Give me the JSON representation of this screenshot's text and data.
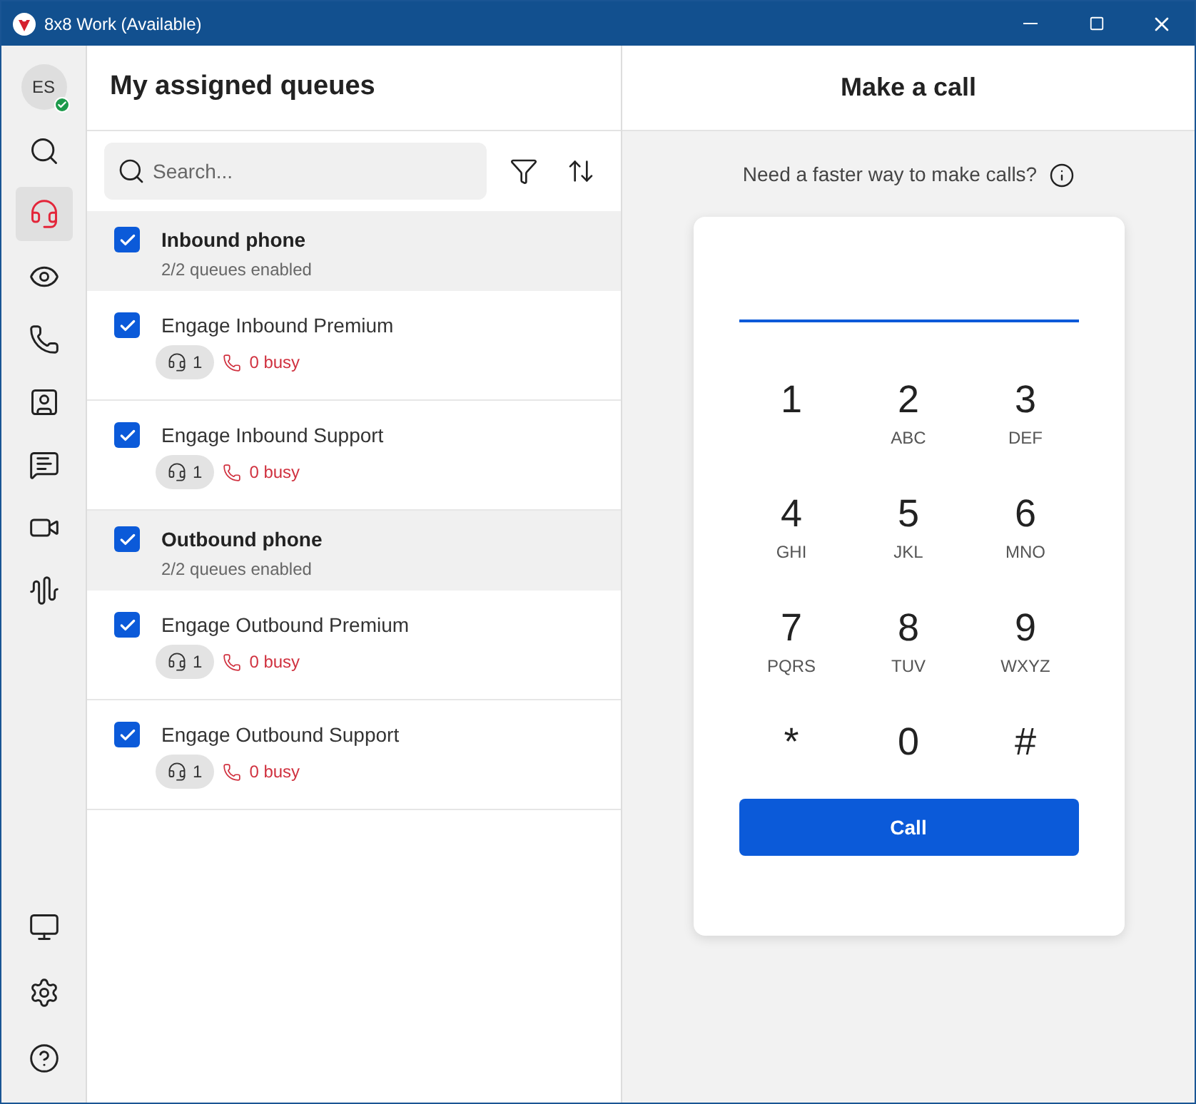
{
  "window": {
    "title": "8x8 Work (Available)"
  },
  "user": {
    "initials": "ES",
    "available": true
  },
  "nav": [
    {
      "selected": false
    },
    {
      "selected": true
    },
    {
      "selected": false
    },
    {
      "selected": false
    },
    {
      "selected": false
    },
    {
      "selected": false
    },
    {
      "selected": false
    },
    {
      "selected": false
    }
  ],
  "queues_panel": {
    "title": "My assigned queues",
    "search": {
      "placeholder": "Search..."
    },
    "rows": [
      {
        "kind": "group",
        "name": "Inbound phone",
        "subtitle": "2/2 queues enabled",
        "checked": true
      },
      {
        "kind": "queue",
        "name": "Engage Inbound Premium",
        "agents": "1",
        "busy": "0 busy",
        "checked": true
      },
      {
        "kind": "queue",
        "name": "Engage Inbound Support",
        "agents": "1",
        "busy": "0 busy",
        "checked": true
      },
      {
        "kind": "group",
        "name": "Outbound phone",
        "subtitle": "2/2 queues enabled",
        "checked": true
      },
      {
        "kind": "queue",
        "name": "Engage Outbound Premium",
        "agents": "1",
        "busy": "0 busy",
        "checked": true
      },
      {
        "kind": "queue",
        "name": "Engage Outbound Support",
        "agents": "1",
        "busy": "0 busy",
        "checked": true
      }
    ]
  },
  "call_panel": {
    "title": "Make a call",
    "hint": "Need a faster way to make calls?",
    "keys": [
      {
        "digit": "1"
      },
      {
        "digit": "2",
        "letters": "ABC"
      },
      {
        "digit": "3",
        "letters": "DEF"
      },
      {
        "digit": "4",
        "letters": "GHI"
      },
      {
        "digit": "5",
        "letters": "JKL"
      },
      {
        "digit": "6",
        "letters": "MNO"
      },
      {
        "digit": "7",
        "letters": "PQRS"
      },
      {
        "digit": "8",
        "letters": "TUV"
      },
      {
        "digit": "9",
        "letters": "WXYZ"
      },
      {
        "digit": "*"
      },
      {
        "digit": "0"
      },
      {
        "digit": "#"
      }
    ],
    "call_button": "Call"
  }
}
